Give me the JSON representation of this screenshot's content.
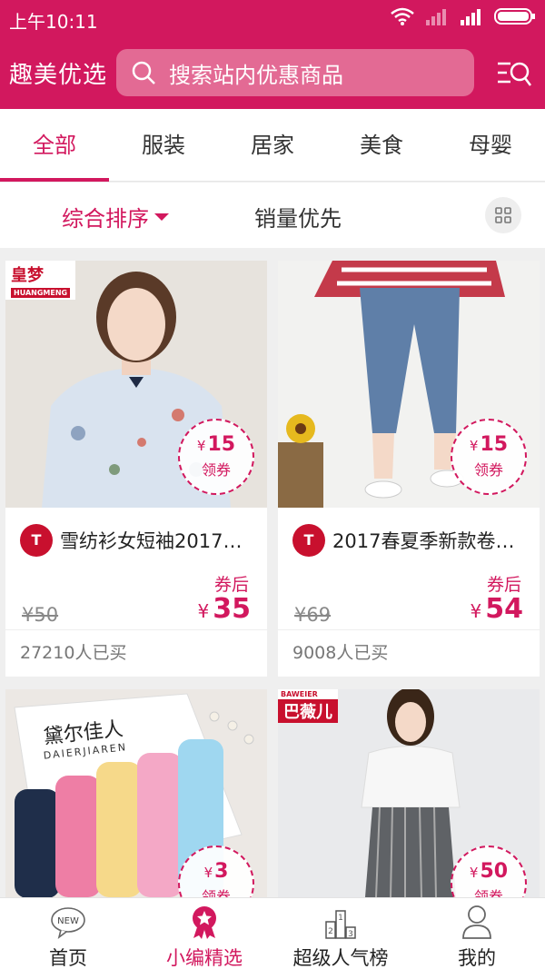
{
  "status_bar": {
    "time": "上午10:11"
  },
  "header": {
    "brand": "趣美优选",
    "search_placeholder": "搜索站内优惠商品"
  },
  "tabs": [
    {
      "label": "全部",
      "active": true
    },
    {
      "label": "服装",
      "active": false
    },
    {
      "label": "居家",
      "active": false
    },
    {
      "label": "美食",
      "active": false
    },
    {
      "label": "母婴",
      "active": false
    }
  ],
  "sort": {
    "comprehensive": "综合排序",
    "sales": "销量优先"
  },
  "products": [
    {
      "title": "雪纺衫女短袖2017…",
      "store_logo": "T",
      "coupon_currency": "¥",
      "coupon_amount": "15",
      "coupon_label": "领券",
      "after_label": "券后",
      "original_price": "¥50",
      "price_currency": "¥",
      "price": "35",
      "sold": "27210人已买",
      "brand_tag": "皇梦",
      "brand_tag_sub": "HUANGMENG"
    },
    {
      "title": "2017春夏季新款卷…",
      "store_logo": "T",
      "coupon_currency": "¥",
      "coupon_amount": "15",
      "coupon_label": "领券",
      "after_label": "券后",
      "original_price": "¥69",
      "price_currency": "¥",
      "price": "54",
      "sold": "9008人已买"
    },
    {
      "coupon_currency": "¥",
      "coupon_amount": "3",
      "coupon_label": "领券",
      "box_text": "黛尔佳人",
      "box_text_sub": "DAIERJIAREN"
    },
    {
      "coupon_currency": "¥",
      "coupon_amount": "50",
      "coupon_label": "领券",
      "brand_tag": "巴薇儿",
      "brand_tag_sub": "BAWEIER"
    }
  ],
  "bottom_nav": [
    {
      "label": "首页",
      "icon": "new-badge-icon",
      "badge": "NEW",
      "active": false
    },
    {
      "label": "小编精选",
      "icon": "star-medal-icon",
      "active": true
    },
    {
      "label": "超级人气榜",
      "icon": "podium-icon",
      "active": false
    },
    {
      "label": "我的",
      "icon": "user-icon",
      "active": false
    }
  ],
  "colors": {
    "primary": "#d2185e",
    "search_bg": "#e36a94",
    "text_dark": "#222222"
  }
}
